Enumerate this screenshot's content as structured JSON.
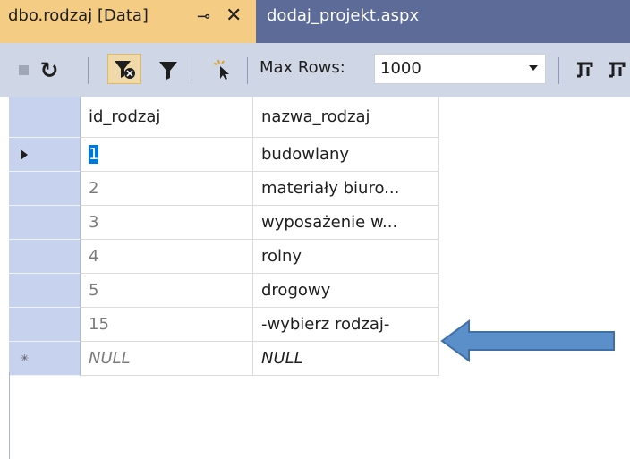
{
  "tabs": {
    "active": {
      "title": "dbo.rodzaj [Data]",
      "pin_glyph": "⊸",
      "close_glyph": "✕"
    },
    "other": {
      "title": "dodaj_projekt.aspx"
    }
  },
  "toolbar": {
    "max_rows_label": "Max Rows:",
    "max_rows_value": "1000"
  },
  "grid": {
    "columns": [
      "id_rodzaj",
      "nazwa_rodzaj"
    ],
    "rows": [
      {
        "id": "1",
        "name": "budowlany"
      },
      {
        "id": "2",
        "name": "materiały biuro..."
      },
      {
        "id": "3",
        "name": "wyposażenie w..."
      },
      {
        "id": "4",
        "name": "rolny"
      },
      {
        "id": "5",
        "name": "drogowy"
      },
      {
        "id": "15",
        "name": "-wybierz rodzaj-"
      }
    ],
    "new_row": {
      "id": "NULL",
      "name": "NULL"
    }
  },
  "colors": {
    "tab_active": "#f5cc84",
    "tabstrip": "#5d6b99",
    "toolbar": "#cfd6e5",
    "row_header": "#c6d2ee",
    "annotation_arrow": "#5b8fc9"
  }
}
